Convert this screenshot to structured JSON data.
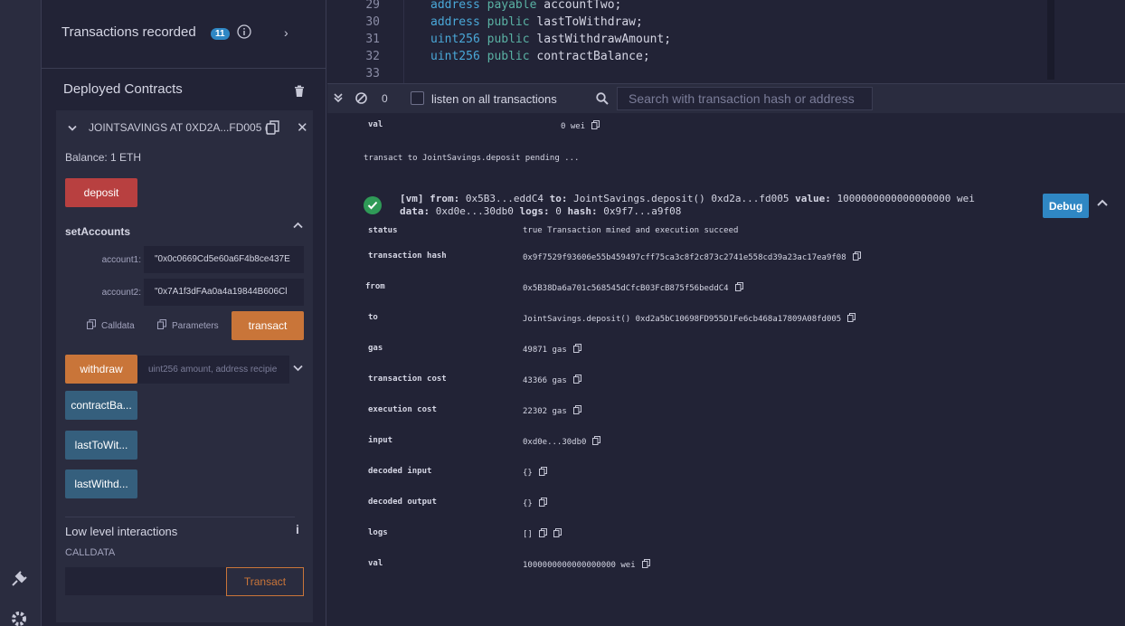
{
  "panel": {
    "tx_recorded_label": "Transactions recorded",
    "tx_recorded_count": "11",
    "deployed_title": "Deployed Contracts",
    "contract": {
      "name": "JOINTSAVINGS AT 0XD2A...FD005 (",
      "balance": "Balance: 1 ETH",
      "deposit_label": "deposit",
      "set_accounts_title": "setAccounts",
      "account1_label": "account1:",
      "account1_value": "\"0x0c0669Cd5e60a6F4b8ce437E",
      "account2_label": "account2:",
      "account2_value": "\"0x7A1f3dFAa0a4a19844B606Cl",
      "calldata_label": "Calldata",
      "parameters_label": "Parameters",
      "transact_label": "transact",
      "withdraw_label": "withdraw",
      "withdraw_placeholder": "uint256 amount, address recipie",
      "contract_balance_label": "contractBa...",
      "last_to_withdraw_label": "lastToWit...",
      "last_withdraw_amount_label": "lastWithd..."
    },
    "low_level": {
      "title": "Low level interactions",
      "calldata_label": "CALLDATA",
      "transact_label": "Transact"
    }
  },
  "editor": {
    "lines": [
      {
        "n": "29",
        "kw": "address",
        "kw2": "payable",
        "rest": "accountTwo;"
      },
      {
        "n": "30",
        "kw": "address",
        "kw2": "public",
        "rest": "lastToWithdraw;"
      },
      {
        "n": "31",
        "kw": "uint256",
        "kw2": "public",
        "rest": "lastWithdrawAmount;"
      },
      {
        "n": "32",
        "kw": "uint256",
        "kw2": "public",
        "rest": "contractBalance;"
      },
      {
        "n": "33",
        "kw": "",
        "kw2": "",
        "rest": ""
      }
    ]
  },
  "terminal_bar": {
    "count": "0",
    "listen_label": "listen on all transactions",
    "search_placeholder": "Search with transaction hash or address"
  },
  "terminal": {
    "prev_val_key": "val",
    "prev_val_value": "0 wei",
    "pending": "transact to JointSavings.deposit pending ...",
    "summary_line1_vm": "[vm]",
    "summary_line1_from_key": "from:",
    "summary_line1_from": "0x5B3...eddC4",
    "summary_line1_to_key": "to:",
    "summary_line1_to": "JointSavings.deposit() 0xd2a...fd005",
    "summary_line1_value_key": "value:",
    "summary_line1_value": "1000000000000000000 wei",
    "summary_line2_data_key": "data:",
    "summary_line2_data": "0xd0e...30db0",
    "summary_line2_logs_key": "logs:",
    "summary_line2_logs": "0",
    "summary_line2_hash_key": "hash:",
    "summary_line2_hash": "0x9f7...a9f08",
    "debug_label": "Debug",
    "rows": [
      {
        "key": "status",
        "value": "true Transaction mined and execution succeed"
      },
      {
        "key": "transaction hash",
        "value": "0x9f7529f93606e55b459497cff75ca3c8f2c873c2741e558cd39a23ac17ea9f08"
      },
      {
        "key": "from",
        "value": "0x5B38Da6a701c568545dCfcB03FcB875f56beddC4"
      },
      {
        "key": "to",
        "value": "JointSavings.deposit() 0xd2a5bC10698FD955D1Fe6cb468a17809A08fd005"
      },
      {
        "key": "gas",
        "value": "49871 gas"
      },
      {
        "key": "transaction cost",
        "value": "43366 gas"
      },
      {
        "key": "execution cost",
        "value": "22302 gas"
      },
      {
        "key": "input",
        "value": "0xd0e...30db0"
      },
      {
        "key": "decoded input",
        "value": "{}"
      },
      {
        "key": "decoded output",
        "value": "{}"
      },
      {
        "key": "logs",
        "value": "[]"
      },
      {
        "key": "val",
        "value": "1000000000000000000 wei"
      }
    ]
  },
  "colors": {
    "background": "#222336",
    "panel": "#2a2c3f",
    "deposit": "#b84040",
    "transact": "#c97539",
    "call": "#355f7d",
    "accent": "#2f87c4"
  }
}
